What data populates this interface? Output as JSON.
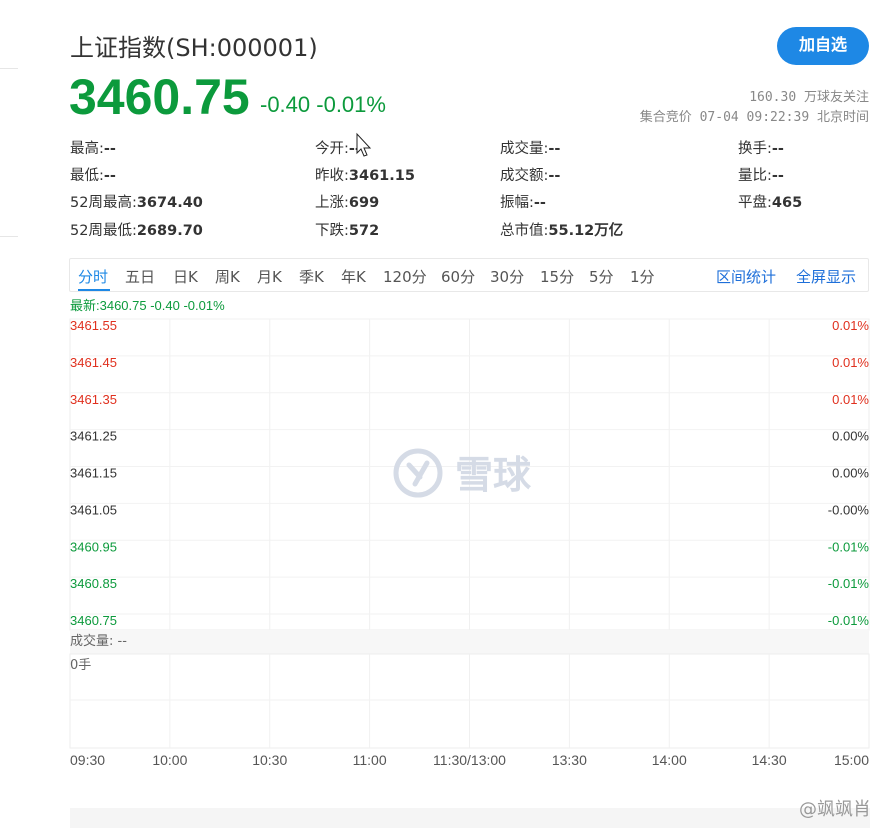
{
  "header": {
    "title": "上证指数(SH:000001)",
    "follow_button": "加自选",
    "price": "3460.75",
    "change": "-0.40  -0.01%",
    "followers": "160.30 万球友关注",
    "auction": "集合竞价 07-04 09:22:39 北京时间"
  },
  "stats": [
    {
      "label": "最高:",
      "value": "--"
    },
    {
      "label": "今开:",
      "value": "--"
    },
    {
      "label": "成交量:",
      "value": "--"
    },
    {
      "label": "换手:",
      "value": "--"
    },
    {
      "label": "最低:",
      "value": "--"
    },
    {
      "label": "昨收:",
      "value": "3461.15"
    },
    {
      "label": "成交额:",
      "value": "--"
    },
    {
      "label": "量比:",
      "value": "--"
    },
    {
      "label": "52周最高:",
      "value": "3674.40"
    },
    {
      "label": "上涨:",
      "value": "699"
    },
    {
      "label": "振幅:",
      "value": "--"
    },
    {
      "label": "平盘:",
      "value": "465"
    },
    {
      "label": "52周最低:",
      "value": "2689.70"
    },
    {
      "label": "下跌:",
      "value": "572"
    },
    {
      "label": "总市值:",
      "value": "55.12万亿"
    }
  ],
  "tabs": [
    "分时",
    "五日",
    "日K",
    "周K",
    "月K",
    "季K",
    "年K",
    "120分",
    "60分",
    "30分",
    "15分",
    "5分",
    "1分"
  ],
  "tab_links": [
    "区间统计",
    "全屏显示"
  ],
  "latest": "最新:3460.75  -0.40  -0.01%",
  "watermark": "雪球",
  "weibo_tag": "@飒飒肖",
  "colors": {
    "up": "#e0301e",
    "down": "#0c9a3c",
    "accent": "#1e88e5"
  },
  "chart_data": {
    "type": "line",
    "price_ticks": [
      "3461.55",
      "3461.45",
      "3461.35",
      "3461.25",
      "3461.15",
      "3461.05",
      "3460.95",
      "3460.85",
      "3460.75"
    ],
    "pct_ticks": [
      "0.01%",
      "0.01%",
      "0.01%",
      "0.00%",
      "0.00%",
      "-0.00%",
      "-0.01%",
      "-0.01%",
      "-0.01%"
    ],
    "tick_colors": [
      "up",
      "up",
      "up",
      "flat",
      "flat",
      "flat",
      "down",
      "down",
      "down"
    ],
    "volume_label": "成交量: --",
    "volume_value": "0手",
    "x_ticks": [
      "09:30",
      "10:00",
      "10:30",
      "11:00",
      "11:30/13:00",
      "13:30",
      "14:00",
      "14:30",
      "15:00"
    ],
    "series": []
  }
}
